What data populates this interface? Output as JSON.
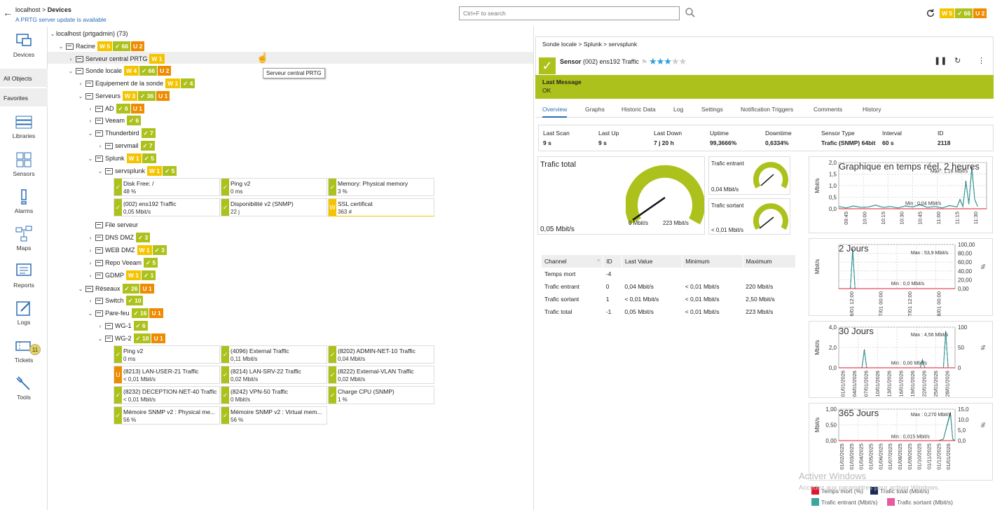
{
  "header": {
    "crumb_root": "localhost",
    "crumb_sep": " > ",
    "crumb_current": "Devices",
    "update": "A PRTG server update is available",
    "search_placeholder": "Ctrl+F to search",
    "badges": {
      "w": "W 5",
      "ok": "✓ 66",
      "u": "U 2"
    }
  },
  "sidebar": {
    "items": [
      {
        "label": "Devices",
        "icon": "devices-icon"
      },
      {
        "label": "All Objects"
      },
      {
        "label": "Favorites"
      },
      {
        "label": "Libraries",
        "icon": "libraries-icon"
      },
      {
        "label": "Sensors",
        "icon": "sensors-icon"
      },
      {
        "label": "Alarms",
        "icon": "alarms-icon"
      },
      {
        "label": "Maps",
        "icon": "maps-icon"
      },
      {
        "label": "Reports",
        "icon": "reports-icon"
      },
      {
        "label": "Logs",
        "icon": "logs-icon"
      },
      {
        "label": "Tickets",
        "icon": "tickets-icon",
        "count": "11"
      },
      {
        "label": "Tools",
        "icon": "tools-icon"
      }
    ]
  },
  "tree": {
    "root": "localhost (prtgadmin) (73)",
    "rows": [
      {
        "label": "Racine",
        "b": [
          "W 5",
          "✓ 66",
          "U 2"
        ]
      },
      {
        "label": "Serveur central PRTG",
        "b": [
          "W 1"
        ]
      },
      {
        "label": "Sonde locale",
        "b": [
          "W 4",
          "✓ 66",
          "U 2"
        ]
      },
      {
        "label": "Equipement de la sonde",
        "b": [
          "W 1",
          "✓ 4"
        ]
      },
      {
        "label": "Serveurs",
        "b": [
          "W 3",
          "✓ 36",
          "U 1"
        ]
      },
      {
        "label": "AD",
        "b": [
          "✓ 6",
          "U 1"
        ]
      },
      {
        "label": "Veeam",
        "b": [
          "✓ 6"
        ]
      },
      {
        "label": "Thunderbird",
        "b": [
          "✓ 7"
        ]
      },
      {
        "label": "servmail",
        "b": [
          "✓ 7"
        ]
      },
      {
        "label": "Splunk",
        "b": [
          "W 1",
          "✓ 5"
        ]
      },
      {
        "label": "servsplunk",
        "b": [
          "W 1",
          "✓ 5"
        ]
      },
      {
        "label": "File serveur",
        "b": []
      },
      {
        "label": "DNS DMZ",
        "b": [
          "✓ 3"
        ]
      },
      {
        "label": "WEB DMZ",
        "b": [
          "W 1",
          "✓ 3"
        ]
      },
      {
        "label": "Repo Veeam",
        "b": [
          "✓ 5"
        ]
      },
      {
        "label": "GDMP",
        "b": [
          "W 1",
          "✓ 1"
        ]
      },
      {
        "label": "Réseaux",
        "b": [
          "✓ 26",
          "U 1"
        ]
      },
      {
        "label": "Switch",
        "b": [
          "✓ 10"
        ]
      },
      {
        "label": "Pare-feu",
        "b": [
          "✓ 16",
          "U 1"
        ]
      },
      {
        "label": "WG-1",
        "b": [
          "✓ 6"
        ]
      },
      {
        "label": "WG-2",
        "b": [
          "✓ 10",
          "U 1"
        ]
      }
    ],
    "tooltip": "Serveur central PRTG",
    "splunk_tiles": [
      {
        "name": "Disk Free: /",
        "value": "48 %",
        "s": "ok"
      },
      {
        "name": "Ping v2",
        "value": "0 ms",
        "s": "ok"
      },
      {
        "name": "Memory: Physical memory",
        "value": "3 %",
        "s": "ok"
      },
      {
        "name": "(002) ens192 Traffic",
        "value": "0,05 Mbit/s",
        "s": "ok"
      },
      {
        "name": "Disponibilité v2 (SNMP)",
        "value": "22 j",
        "s": "ok"
      },
      {
        "name": "SSL certificat",
        "value": "363 #",
        "s": "w"
      }
    ],
    "wg2_tiles": [
      {
        "name": "Ping v2",
        "value": "0 ms",
        "s": "ok"
      },
      {
        "name": "(4096) External Traffic",
        "value": "0,11 Mbit/s",
        "s": "ok"
      },
      {
        "name": "(8202) ADMIN-NET-10 Traffic",
        "value": "0,04 Mbit/s",
        "s": "ok"
      },
      {
        "name": "(8213) LAN-USER-21 Traffic",
        "value": "< 0,01 Mbit/s",
        "s": "u"
      },
      {
        "name": "(8214) LAN-SRV-22 Traffic",
        "value": "0,02 Mbit/s",
        "s": "ok"
      },
      {
        "name": "(8222) External-VLAN Traffic",
        "value": "0,02 Mbit/s",
        "s": "ok"
      },
      {
        "name": "(8232) DECEPTION-NET-40 Traffic",
        "value": "< 0,01 Mbit/s",
        "s": "ok"
      },
      {
        "name": "(8242) VPN-50 Traffic",
        "value": "0 Mbit/s",
        "s": "ok"
      },
      {
        "name": "Charge CPU (SNMP)",
        "value": "1 %",
        "s": "ok"
      },
      {
        "name": "Mémoire SNMP v2 : Physical me...",
        "value": "56 %",
        "s": "ok"
      },
      {
        "name": "Mémoire SNMP v2 : Virtual mem...",
        "value": "56 %",
        "s": "ok"
      }
    ]
  },
  "panel": {
    "crumb": "Sonde locale > Splunk > servsplunk",
    "sensor_prefix": "Sensor",
    "sensor_name": "(002) ens192 Traffic",
    "stars_on": "★★★",
    "stars_off": "★★",
    "last_message_label": "Last Message",
    "last_message": "OK",
    "tabs": [
      "Overview",
      "Graphs",
      "Historic Data",
      "Log",
      "Settings",
      "Notification Triggers",
      "Comments",
      "History"
    ],
    "info": [
      {
        "k": "Last Scan",
        "v": "9 s"
      },
      {
        "k": "Last Up",
        "v": "9 s"
      },
      {
        "k": "Last Down",
        "v": "7 j 20 h"
      },
      {
        "k": "Uptime",
        "v": "99,3666%"
      },
      {
        "k": "Downtime",
        "v": "0,6334%"
      },
      {
        "k": "Sensor Type",
        "v": "Trafic (SNMP) 64bit"
      },
      {
        "k": "Interval",
        "v": "60 s"
      },
      {
        "k": "ID",
        "v": "2118"
      }
    ],
    "gauges": {
      "total_title": "Trafic total",
      "total_value": "0,05 Mbit/s",
      "total_min": "0 Mbit/s",
      "total_max": "223 Mbit/s",
      "in_title": "Trafic entrant",
      "in_value": "0,04 Mbit/s",
      "out_title": "Trafic sortant",
      "out_value": "< 0,01 Mbit/s"
    },
    "table": {
      "headers": [
        "Channel",
        "ID",
        "Last Value",
        "Minimum",
        "Maximum"
      ],
      "rows": [
        [
          "Temps mort",
          "-4",
          "",
          "",
          ""
        ],
        [
          "Trafic entrant",
          "0",
          "0,04 Mbit/s",
          "< 0,01 Mbit/s",
          "220 Mbit/s"
        ],
        [
          "Trafic sortant",
          "1",
          "< 0,01 Mbit/s",
          "< 0,01 Mbit/s",
          "2,50 Mbit/s"
        ],
        [
          "Trafic total",
          "-1",
          "0,05 Mbit/s",
          "< 0,01 Mbit/s",
          "223 Mbit/s"
        ]
      ]
    }
  },
  "chart_data": [
    {
      "type": "line",
      "title": "Graphique en temps réel, 2 heures",
      "ylabel": "Mbit/s",
      "yticks": [
        "2,0",
        "1,5",
        "1,0",
        "0,5",
        "0,0"
      ],
      "x": [
        "09:45",
        "10:00",
        "10:15",
        "10:30",
        "10:45",
        "11:00",
        "11:15",
        "11:30"
      ],
      "max_label": "Max : 1,18 Mbit/s",
      "min_label": "Min : 0,04 Mbit/s"
    },
    {
      "type": "line",
      "title": "2 Jours",
      "ylabel": "Mbit/s",
      "y2label": "%",
      "yticks2": [
        "100,00",
        "80,00",
        "60,00",
        "40,00",
        "20,00",
        "0,00"
      ],
      "x": [
        "26/01 12:00",
        "27/01 00:00",
        "27/01 12:00",
        "28/01 00:00"
      ],
      "max_label": "Max : 53,9 Mbit/s",
      "min_label": "Min : 0,0 Mbit/s"
    },
    {
      "type": "line",
      "title": "30 Jours",
      "ylabel": "Mbit/s",
      "y2label": "%",
      "yticks": [
        "4,0",
        "2,0",
        "0,0"
      ],
      "yticks2": [
        "100",
        "50",
        "0"
      ],
      "x": [
        "01/01/2026",
        "04/01/2026",
        "07/01/2026",
        "10/01/2026",
        "13/01/2026",
        "16/01/2026",
        "19/01/2026",
        "22/01/2026",
        "25/01/2026",
        "28/01/2026"
      ],
      "max_label": "Max : 4,56 Mbit/s",
      "min_label": "Min : 0,00 Mbit/s"
    },
    {
      "type": "line",
      "title": "365 Jours",
      "ylabel": "Mbit/s",
      "y2label": "%",
      "yticks": [
        "1,00",
        "0,50",
        "0,00"
      ],
      "yticks2": [
        "15,0",
        "10,0",
        "5,0",
        "0,0"
      ],
      "x": [
        "01/02/2025",
        "01/03/2025",
        "01/04/2025",
        "01/05/2025",
        "01/06/2025",
        "01/07/2025",
        "01/08/2025",
        "01/09/2025",
        "01/10/2025",
        "01/11/2025",
        "01/12/2025",
        "01/01/2026"
      ],
      "max_label": "Max : 0,270 Mbit/s",
      "min_label": "Min : 0,015 Mbit/s"
    }
  ],
  "legend": [
    {
      "label": "Temps mort  (%)",
      "color": "#e0182d"
    },
    {
      "label": "Trafic total  (Mbit/s)",
      "color": "#1b2a55"
    },
    {
      "label": "Trafic entrant  (Mbit/s)",
      "color": "#3aa6a0"
    },
    {
      "label": "Trafic sortant  (Mbit/s)",
      "color": "#e65aa0"
    }
  ],
  "watermark": {
    "line1": "Activer Windows",
    "line2": "Accédez aux paramètres pour activer Windows."
  }
}
